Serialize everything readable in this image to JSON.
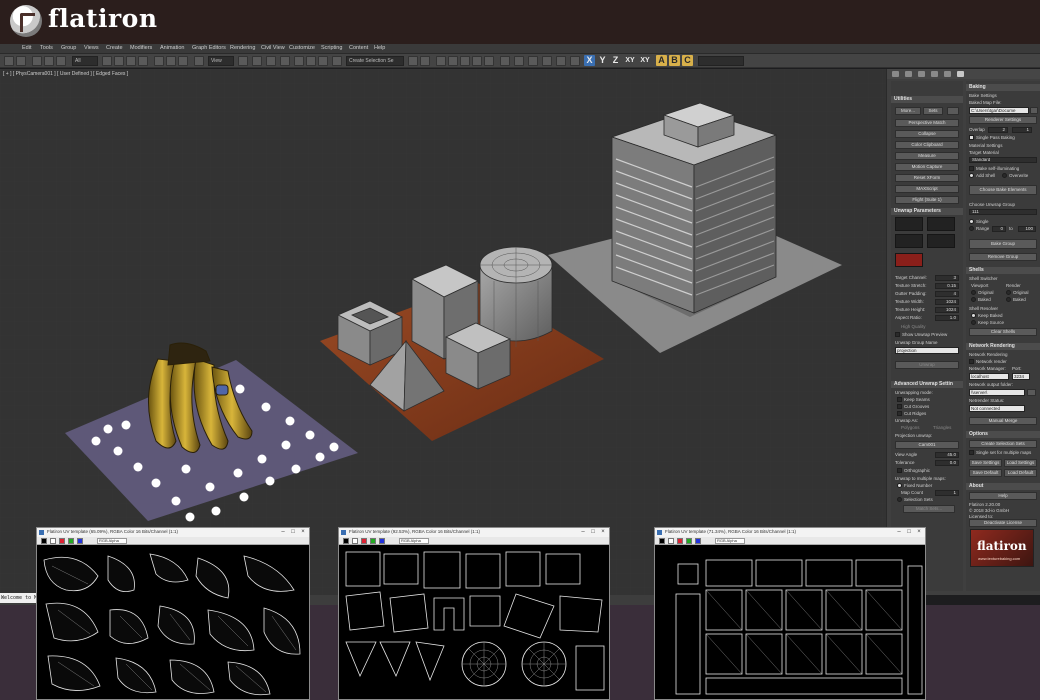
{
  "brand": {
    "name": "flatiron"
  },
  "menu": [
    "Edit",
    "Tools",
    "Group",
    "Views",
    "Create",
    "Modifiers",
    "Animation",
    "Graph Editors",
    "Rendering",
    "Civil View",
    "Customize",
    "Scripting",
    "Content",
    "Help"
  ],
  "toolbar": {
    "selection_filter": "All",
    "reference_coord": "View",
    "selection_set": "Create Selection Se",
    "axis_letters": [
      "X",
      "Y",
      "Z",
      "XY",
      "XY"
    ],
    "extra_letters": [
      "A",
      "B",
      "C"
    ]
  },
  "viewport": {
    "label": "[ + ] [ PhysCamera001 ] [ User Defined ] [ Edged Faces ]"
  },
  "maxscript": {
    "text": "Welcome to M"
  },
  "utilities": {
    "header": "Utilities",
    "more": "More...",
    "sets": "Sets",
    "buttons": [
      "Perspective Match",
      "Collapse",
      "Color Clipboard",
      "Measure",
      "Motion Capture",
      "Reset XForm",
      "MAXScript",
      "Flight (Suite 1)"
    ]
  },
  "unwrap": {
    "header": "Unwrap Parameters",
    "fields": [
      {
        "label": "Target Channel:",
        "value": "3"
      },
      {
        "label": "Texture Stretch:",
        "value": "0.15"
      },
      {
        "label": "Gutter Padding:",
        "value": "4"
      },
      {
        "label": "Texture Width:",
        "value": "1024"
      },
      {
        "label": "Texture Height:",
        "value": "1024"
      },
      {
        "label": "Aspect Ratio:",
        "value": "1.0"
      }
    ],
    "high_quality": "High Quality",
    "show_preview": "Show Unwrap Preview",
    "group_name_label": "Unwrap Group Name",
    "group_name": "projection",
    "unwrap_button": "Unwrap"
  },
  "advanced": {
    "header": "Advanced Unwrap Settin",
    "mode_label": "Unwrapping mode:",
    "keep_seams": "Keep Seams",
    "cut_grooves": "Cut Grooves",
    "cut_ridges": "Cut Ridges",
    "unwrap_as": "Unwrap As:",
    "polygons": "Polygons",
    "triangles": "Triangles",
    "projection_label": "Projection unwrap:",
    "camera_button": "Cam001",
    "view_angle_label": "View Angle",
    "view_angle": "45.0",
    "tolerance_label": "Tolerance",
    "tolerance": "0.0",
    "orthographic": "Orthographic",
    "multiple_maps": "Unwrap to multiple maps:",
    "fixed_number": "Fixed Number",
    "map_count_label": "Map Count",
    "map_count": "1",
    "selection_sets": "Selection Sets",
    "match_sets": "Match Sets..."
  },
  "baking": {
    "header": "Baking",
    "settings_label": "Bake Settings",
    "baked_map_label": "Baked Map File:",
    "baked_map": "C:\\Users\\tgar\\Docume",
    "renderer_settings": "Renderer Settings",
    "overlap_label": "Overlap",
    "overlap_a": "2",
    "overlap_b": "1",
    "single_pass": "Single Pass Baking",
    "material_settings": "Material Settings",
    "target_material": "Target Material",
    "material": "Standard",
    "self_illum": "Make self-illuminating",
    "add_shell": "Add Shell",
    "overwrite": "Overwrite",
    "choose_elements": "Choose Bake Elements",
    "choose_group": "Choose Unwrap Group",
    "group_value": "111",
    "single": "Single",
    "range": "Range",
    "range_from": "0",
    "range_to_label": "to",
    "range_to": "100",
    "bake_group": "Bake Group",
    "remove_group": "Remove Group"
  },
  "shells": {
    "header": "Shells",
    "switcher": "Shell Switcher",
    "viewport": "Viewport",
    "render": "Render",
    "original": "Original",
    "baked": "Baked",
    "resolver": "Shell Resolver",
    "keep_baked": "Keep Baked",
    "keep_source": "Keep Source",
    "clear_shells": "Clear Shells"
  },
  "network": {
    "header": "Network Rendering",
    "label": "Network Rendering",
    "netrender": "Network render",
    "manager_label": "Network Manager:",
    "port_label": "Port:",
    "manager": "localhost",
    "port": "3234",
    "output_label": "Network output folder:",
    "output": "\\\\server\\",
    "status_label": "Netrender Status:",
    "status": "Not connected",
    "manual_merge": "Manual Merge"
  },
  "options": {
    "header": "Options",
    "create_sets": "Create Selection Sets",
    "single_set": "Single set for multiple maps",
    "save_settings": "Save Settings",
    "load_settings": "Load Settings",
    "save_default": "Save Default",
    "load_default": "Load Default"
  },
  "about": {
    "header": "About",
    "help": "Help",
    "version": "Flatiron 2.20.00",
    "copyright": "© 2018 3d-io GmbH",
    "licensed": "Licensed to:",
    "deactivate": "Deactivate License",
    "logo_text": "flatiron",
    "logo_url": "www.texturebaking.com"
  },
  "uv_windows": [
    {
      "title": "Flatiron UV template (65.09%), RGBA Color 16 Bits/Channel (1:1)",
      "channel": "RGB Alpha"
    },
    {
      "title": "Flatiron UV template (92.53%), RGBA Color 16 Bits/Channel (1:1)",
      "channel": "RGB Alpha"
    },
    {
      "title": "Flatiron UV template (71.34%), RGBA Color 16 Bits/Channel (1:1)",
      "channel": "RGB Alpha"
    }
  ],
  "colors": {
    "banner": "#2b1e1c",
    "viewport": "#333333",
    "panel": "#3f3f3f",
    "accent_blue": "#3a6fb2"
  }
}
